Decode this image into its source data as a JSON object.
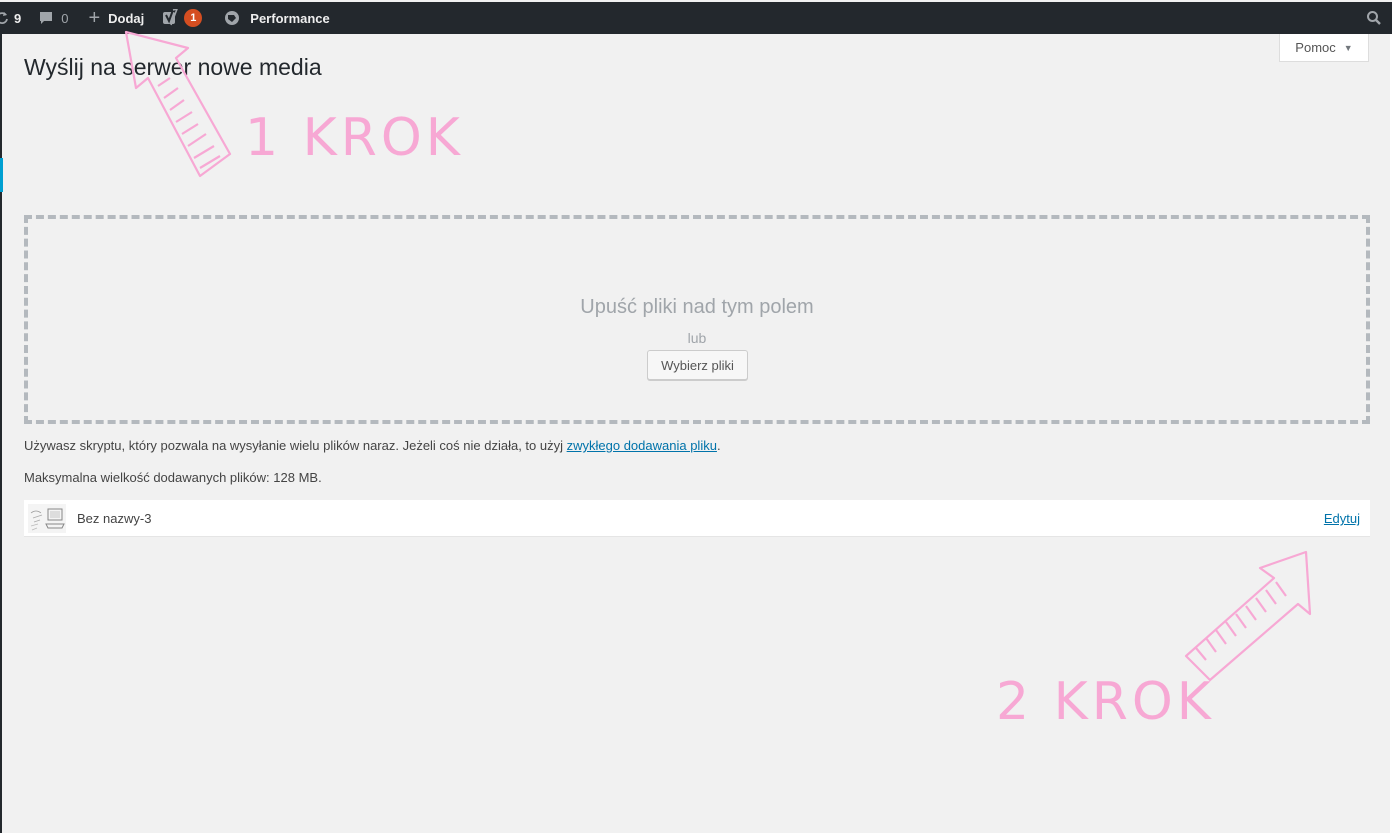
{
  "adminbar": {
    "updates_count": "9",
    "comments_count": "0",
    "new_label": "Dodaj",
    "yoast_badge": "1",
    "performance_label": "Performance"
  },
  "help": {
    "label": "Pomoc"
  },
  "page": {
    "title": "Wyślij na serwer nowe media"
  },
  "dropzone": {
    "title": "Upuść pliki nad tym polem",
    "or": "lub",
    "button": "Wybierz pliki"
  },
  "info": {
    "multi_text": "Używasz skryptu, który pozwala na wysyłanie wielu plików naraz. Jeżeli coś nie działa, to użyj",
    "multi_link": "zwykłego dodawania pliku",
    "max_size": "Maksymalna wielkość dodawanych plików: 128 MB."
  },
  "media_items": [
    {
      "name": "Bez nazwy-3",
      "edit_label": "Edytuj"
    }
  ],
  "annotations": {
    "step1": "1 KROK",
    "step2": "2 KROK"
  },
  "colors": {
    "adminbar_bg": "#23282d",
    "badge": "#d54e21",
    "link": "#0073aa",
    "annotation_pink": "#f7a8d4"
  }
}
